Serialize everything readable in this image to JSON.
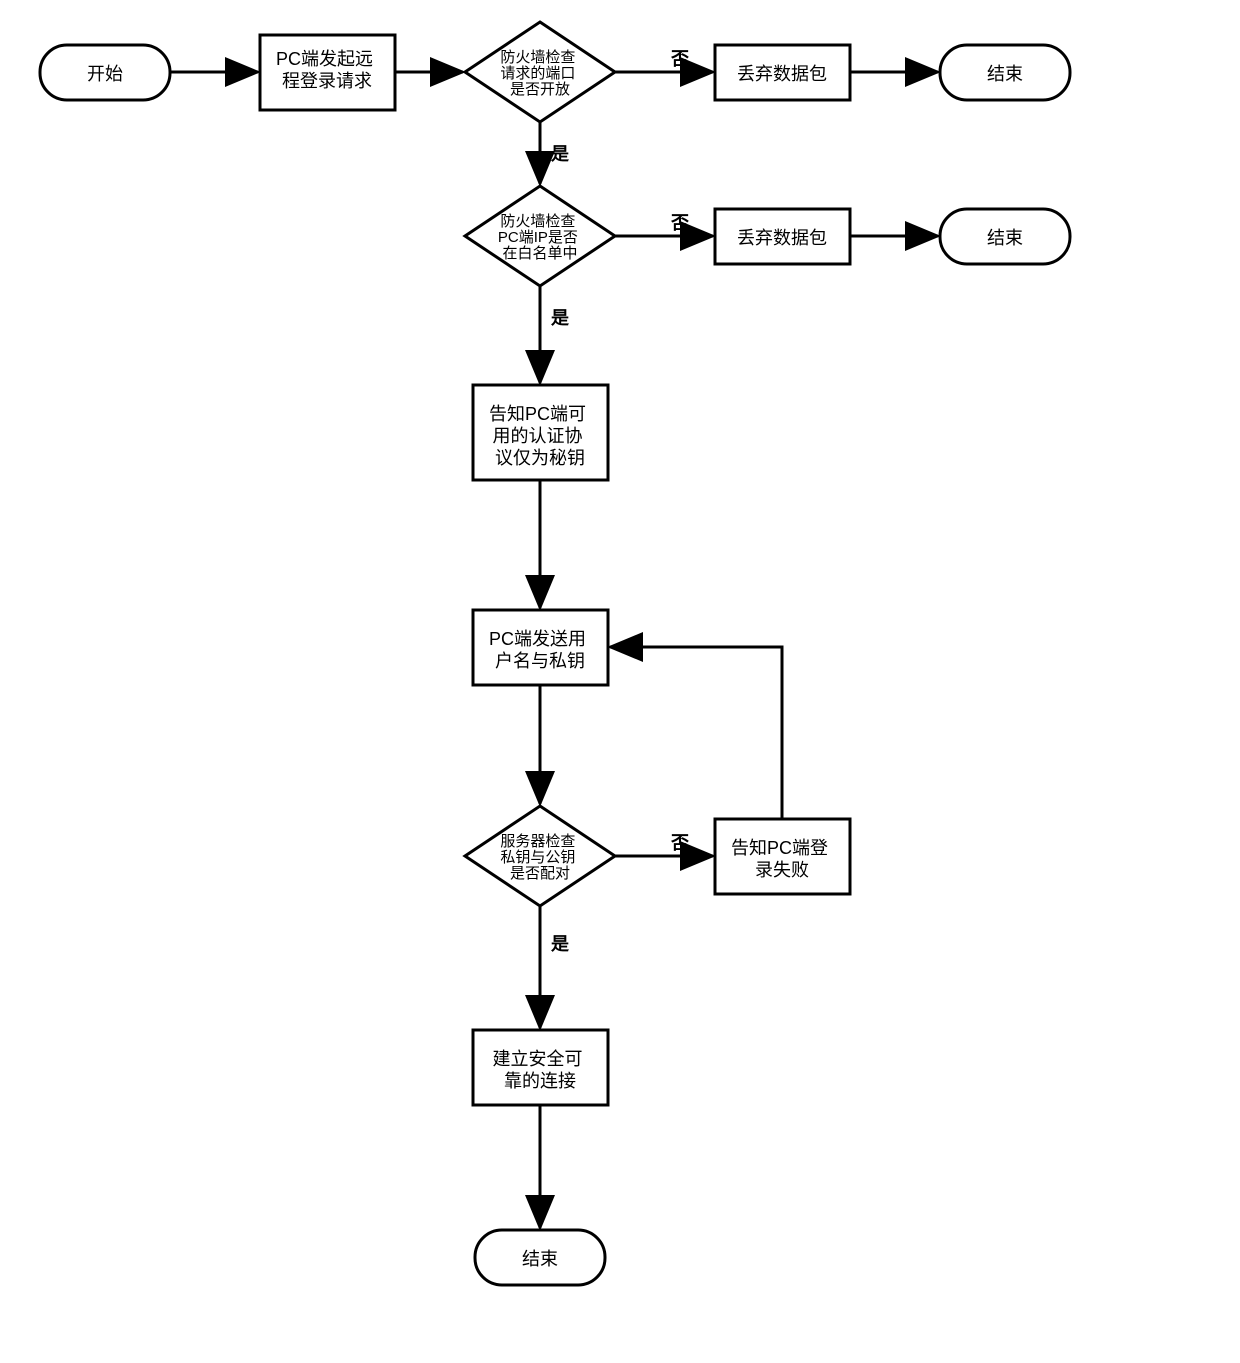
{
  "flowchart": {
    "start": "开始",
    "step1": "PC端发起远程登录请求",
    "decision1": "防火墙检查请求的端口是否开放",
    "decision1_no": "否",
    "decision1_yes": "是",
    "discard1": "丢弃数据包",
    "end1": "结束",
    "decision2": "防火墙检查PC端IP是否在白名单中",
    "decision2_no": "否",
    "decision2_yes": "是",
    "discard2": "丢弃数据包",
    "end2": "结束",
    "step2_line1": "告知PC端可",
    "step2_line2": "用的认证协",
    "step2_line3": "议仅为秘钥",
    "step3_line1": "PC端发送用",
    "step3_line2": "户名与私钥",
    "decision3_line1": "服务器检查",
    "decision3_line2": "私钥与公钥",
    "decision3_line3": "是否配对",
    "decision3_no": "否",
    "decision3_yes": "是",
    "step4_line1": "告知PC端登",
    "step4_line2": "录失败",
    "step5_line1": "建立安全可",
    "step5_line2": "靠的连接",
    "end3": "结束"
  }
}
